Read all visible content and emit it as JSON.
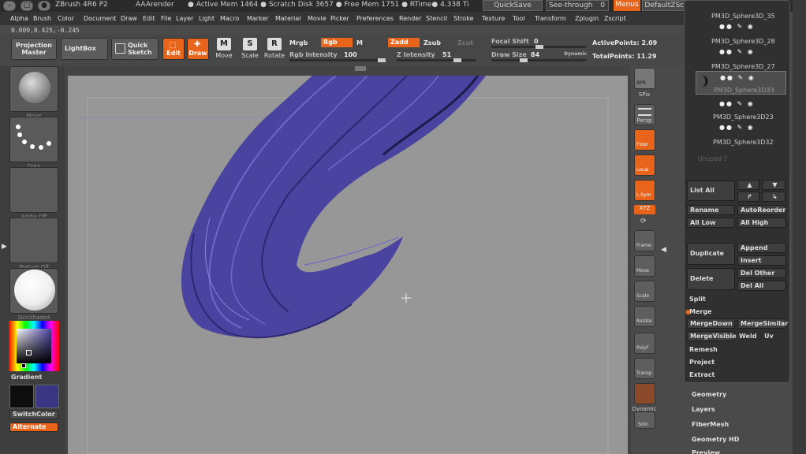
{
  "titlebar": {
    "app": "ZBrush 4R6 P2",
    "render": "AAArender",
    "stats": "● Active Mem 1464  ● Scratch Disk 3657  ● Free Mem 1751  ● RTime● 4.338  Ti",
    "quicksave": "QuickSave",
    "seethrough": "See-through",
    "seethrough_value": "0",
    "menus": "Menus",
    "script": "DefaultZScript"
  },
  "menubar": [
    "Alpha",
    "Brush",
    "Color",
    "Document",
    "Draw",
    "Edit",
    "File",
    "Layer",
    "Light",
    "Macro",
    "Marker",
    "Material",
    "Movie",
    "Picker",
    "Preferences",
    "Render",
    "Stencil",
    "Stroke",
    "Texture",
    "Tool",
    "Transform",
    "Zplugin",
    "Zscript"
  ],
  "coords": "0.009,0.425,-0.245",
  "toolbar": {
    "projection_master": "Projection Master",
    "lightbox": "LightBox",
    "quick_sketch": "Quick Sketch",
    "edit": "Edit",
    "draw": "Draw",
    "move": "Move",
    "scale": "Scale",
    "rotate": "Rotate",
    "mrgb": "Mrgb",
    "rgb": "Rgb",
    "m": "M",
    "zadd": "Zadd",
    "zsub": "Zsub",
    "zcut": "Zcut",
    "rgb_intensity_label": "Rgb Intensity",
    "rgb_intensity": "100",
    "z_intensity_label": "Z Intensity",
    "z_intensity": "51",
    "focal_shift_label": "Focal Shift",
    "focal_shift": "0",
    "draw_size_label": "Draw Size",
    "draw_size": "84",
    "dynamic": "Dynamic",
    "active_points": "ActivePoints: 2.09",
    "total_points": "TotalPoints: 11.29"
  },
  "left": {
    "brush": "Move",
    "stroke": "Dots",
    "alpha": "Alpha Off",
    "texture": "Texture Off",
    "material": "SkinShade4",
    "gradient": "Gradient",
    "switchcolor": "SwitchColor",
    "alternate": "Alternate",
    "main_color": "#0d0d0d",
    "secondary_color": "#3b3683"
  },
  "shelf": [
    "BPR",
    "SPix",
    "Persp",
    "Floor",
    "Local",
    "L.Sym",
    "XYZ",
    "Frame",
    "Move",
    "Scale",
    "Rotate",
    "PolyF",
    "Transp",
    "Dynamic",
    "Solo"
  ],
  "subtool": {
    "items": [
      "PM3D_Sphere3D_35",
      "PM3D_Sphere3D_28",
      "PM3D_Sphere3D_27",
      "PM3D_Sphere3D33",
      "PM3D_Sphere3D23",
      "PM3D_Sphere3D32"
    ],
    "unused": "Unused ?",
    "list_all": "List All",
    "rename": "Rename",
    "autoreorder": "AutoReorder",
    "all_low": "All Low",
    "all_high": "All High",
    "duplicate": "Duplicate",
    "append": "Append",
    "insert": "Insert",
    "delete": "Delete",
    "del_other": "Del Other",
    "del_all": "Del All",
    "split": "Split",
    "merge": "Merge",
    "mergedown": "MergeDown",
    "mergesimilar": "MergeSimilar",
    "mergevisible": "MergeVisible",
    "weld": "Weld",
    "uv": "Uv",
    "remesh": "Remesh",
    "project": "Project",
    "extract": "Extract"
  },
  "tool_menu": [
    "Geometry",
    "Layers",
    "FiberMesh",
    "Geometry HD",
    "Preview"
  ],
  "colors": {
    "accent": "#e8641b",
    "hair": "#4a43a0"
  }
}
